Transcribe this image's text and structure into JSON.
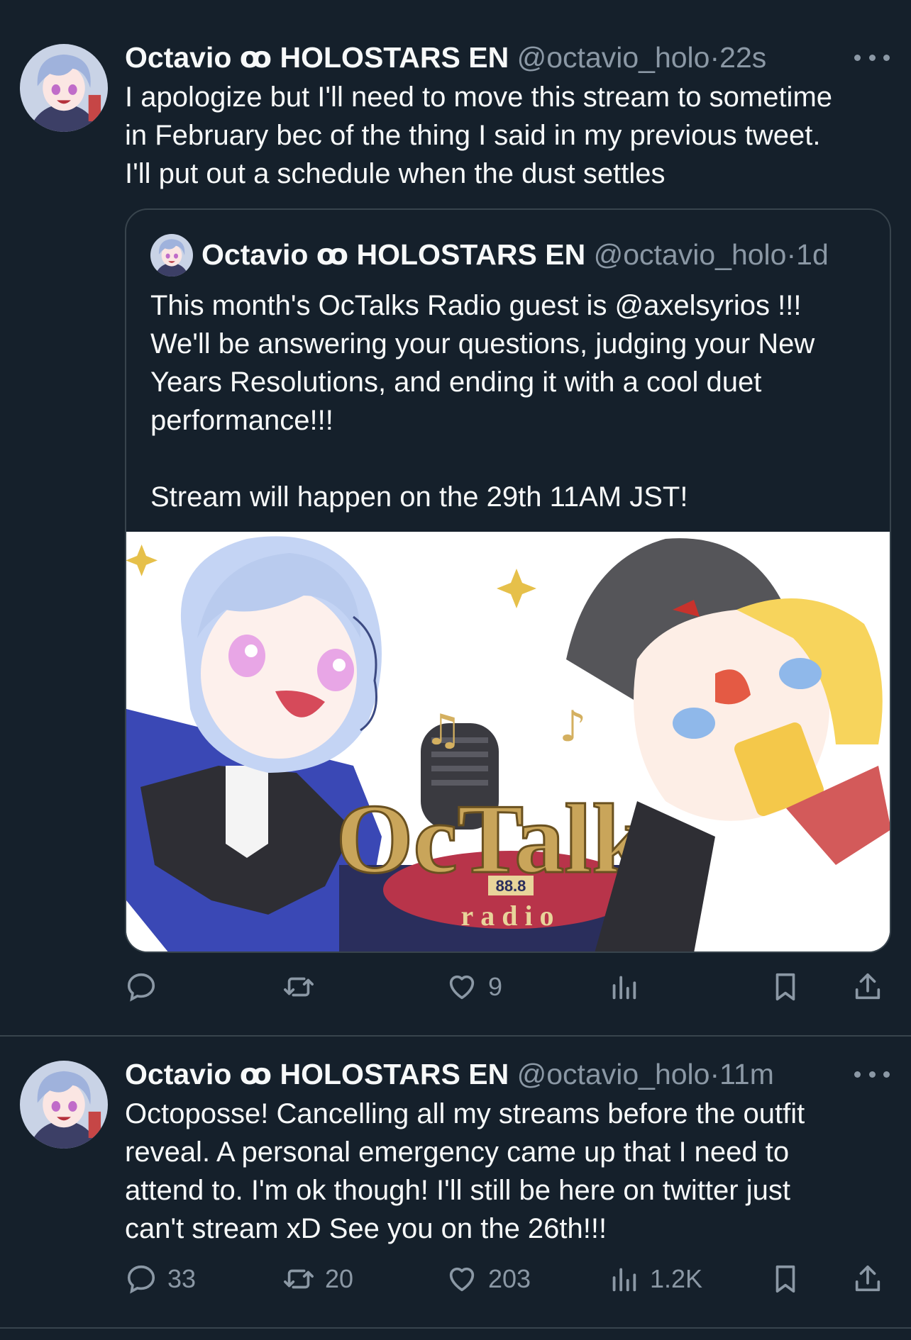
{
  "tweets": [
    {
      "display_name": "Octavio ꝏ HOLOSTARS EN",
      "handle": "@octavio_holo",
      "separator": "·",
      "time": "22s",
      "text": "I apologize but I'll need to move this stream to sometime\nin February bec of the thing I said in my previous tweet.\nI'll put out a schedule when the dust settles",
      "quote": {
        "display_name": "Octavio ꝏ HOLOSTARS EN",
        "handle": "@octavio_holo",
        "separator": "·",
        "time": "1d",
        "text": "This month's OcTalks Radio guest is @axelsyrios !!!\nWe'll be answering your questions, judging your New\nYears Resolutions, and ending it with a cool duet\nperformance!!!\n\nStream will happen on the 29th 11AM JST!",
        "image_logo": "OcTalks",
        "image_freq": "88.8",
        "image_sub": "radio"
      },
      "actions": {
        "reply": "",
        "retweet": "",
        "like": "9",
        "views": ""
      }
    },
    {
      "display_name": "Octavio ꝏ HOLOSTARS EN",
      "handle": "@octavio_holo",
      "separator": "·",
      "time": "11m",
      "text": "Octoposse! Cancelling all my streams before the outfit\nreveal. A personal emergency came up that I need to\nattend to. I'm ok though! I'll still be here on twitter just\ncan't stream xD See you on the 26th!!!",
      "actions": {
        "reply": "33",
        "retweet": "20",
        "like": "203",
        "views": "1.2K"
      }
    }
  ],
  "colors": {
    "background": "#15202b",
    "text": "#f7f9f9",
    "secondary": "#8b98a5",
    "border": "#38444d"
  },
  "icons": [
    "reply-icon",
    "retweet-icon",
    "like-icon",
    "views-icon",
    "bookmark-icon",
    "share-icon",
    "more-icon"
  ]
}
